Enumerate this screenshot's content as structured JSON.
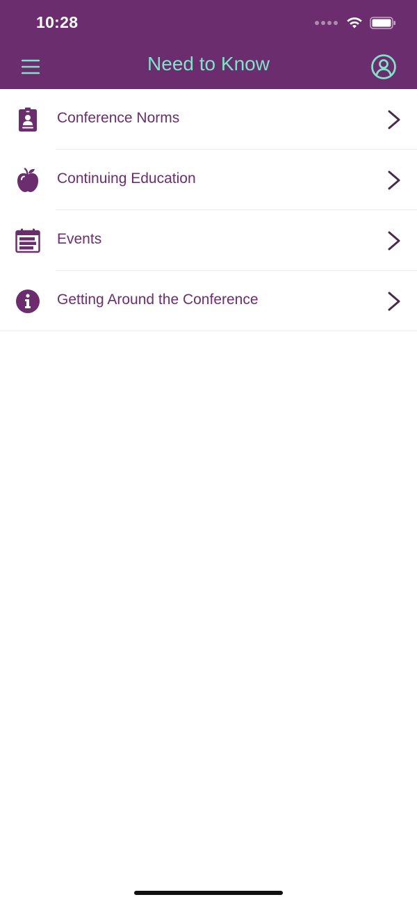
{
  "status_bar": {
    "time": "10:28",
    "icons": [
      "signal-icon",
      "wifi-icon",
      "battery-icon"
    ]
  },
  "header": {
    "title": "Need to Know",
    "left_icon": "hamburger-menu-icon",
    "right_icon": "user-profile-icon"
  },
  "list": {
    "items": [
      {
        "label": "Conference Norms",
        "icon": "id-badge-icon"
      },
      {
        "label": "Continuing Education",
        "icon": "apple-icon"
      },
      {
        "label": "Events",
        "icon": "calendar-icon"
      },
      {
        "label": "Getting Around the Conference",
        "icon": "info-circle-icon"
      }
    ]
  },
  "colors": {
    "header_bg": "#6b2d6d",
    "header_title": "#7fe3c9",
    "item_text": "#6b2d6d",
    "chevron": "#4a2a4a"
  }
}
